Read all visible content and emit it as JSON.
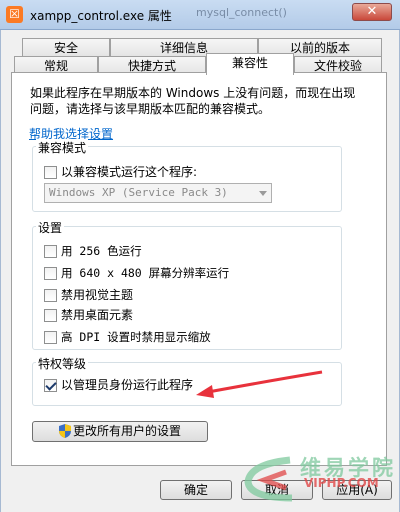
{
  "window": {
    "title": "xampp_control.exe 属性",
    "background_tab": "mysql_connect()",
    "close_symbol": "✕",
    "icon_glyph": "☒"
  },
  "tabs_row1": [
    "安全",
    "详细信息",
    "以前的版本"
  ],
  "tabs_row2": [
    "常规",
    "快捷方式",
    "兼容性",
    "文件校验"
  ],
  "active_tab": "兼容性",
  "description": "如果此程序在早期版本的 Windows 上没有问题，而现在出现问题，请选择与该早期版本匹配的兼容模式。",
  "help_link": "帮助我选择设置",
  "compat_group": {
    "title": "兼容模式",
    "checkbox_label": "以兼容模式运行这个程序:",
    "checked": false,
    "select_value": "Windows XP (Service Pack 3)"
  },
  "settings_group": {
    "title": "设置",
    "items": [
      {
        "label": "用 256 色运行",
        "checked": false
      },
      {
        "label": "用 640 x 480 屏幕分辨率运行",
        "checked": false
      },
      {
        "label": "禁用视觉主题",
        "checked": false
      },
      {
        "label": "禁用桌面元素",
        "checked": false
      },
      {
        "label": "高 DPI 设置时禁用显示缩放",
        "checked": false
      }
    ]
  },
  "privilege_group": {
    "title": "特权等级",
    "checkbox_label": "以管理员身份运行此程序",
    "checked": true
  },
  "change_all_button": "更改所有用户的设置",
  "buttons": {
    "ok": "确定",
    "cancel": "取消",
    "apply": "应用(A)"
  },
  "watermark": {
    "text": "维易学院",
    "url": "VIPHP.COM"
  },
  "colors": {
    "link": "#0066cc",
    "arrow": "#e8323c",
    "titlebar": "#c9dcf2"
  }
}
